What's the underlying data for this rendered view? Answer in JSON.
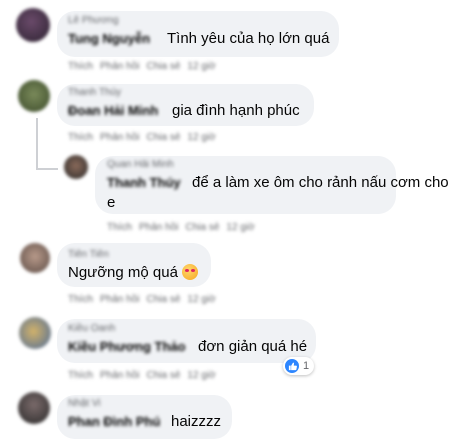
{
  "comments": [
    {
      "id": "c1",
      "badge": "Lê Phương",
      "name": "Tung Nguyễn",
      "text": "Tình yêu của họ lớn quá",
      "actions": [
        "Thích",
        "Phản hồi",
        "Chia sẻ",
        "12 giờ"
      ]
    },
    {
      "id": "c2",
      "badge": "Thanh Thúy",
      "name": "Đoan Hải Minh",
      "text": "gia đình hạnh phúc",
      "actions": [
        "Thích",
        "Phản hồi",
        "Chia sẻ",
        "12 giờ"
      ]
    },
    {
      "id": "c3",
      "badge": "Quan Hải Minh",
      "name": "Thanh Thúy",
      "text_line1": "để a làm xe ôm cho rảnh nấu cơm cho",
      "text_line2": "e",
      "actions": [
        "Thích",
        "Phản hồi",
        "Chia sẻ",
        "12 giờ"
      ]
    },
    {
      "id": "c4",
      "name": "Tiên Tiên",
      "text": "Ngưỡng mộ quá",
      "emoji": "smiling-face-with-hearts",
      "actions": [
        "Thích",
        "Phản hồi",
        "Chia sẻ",
        "12 giờ"
      ]
    },
    {
      "id": "c5",
      "badge": "Kiều Oanh",
      "name": "Kiều Phương Thảo",
      "text": "đơn giản quá hé",
      "actions": [
        "Thích",
        "Phản hồi",
        "Chia sẻ",
        "12 giờ"
      ],
      "reaction_count": "1"
    },
    {
      "id": "c6",
      "badge": "Nhật Vi",
      "name": "Phan Đình Phú",
      "text": "haizzzz"
    }
  ],
  "colors": {
    "bubble": "#f0f2f5",
    "like_blue": "#2d86ff",
    "meta_gray": "#65676b"
  }
}
